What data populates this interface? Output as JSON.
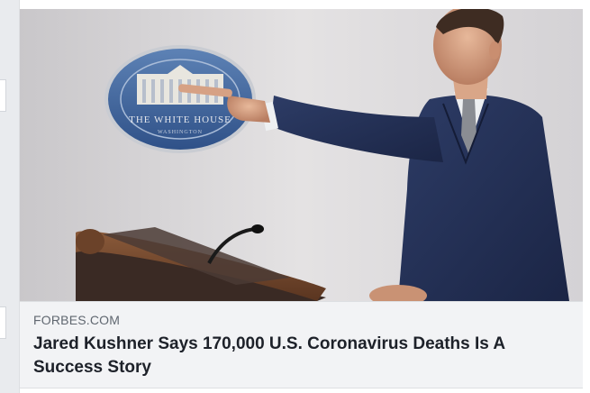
{
  "link_preview": {
    "source": "FORBES.COM",
    "headline": "Jared Kushner Says 170,000 U.S. Coronavirus Deaths Is A Success Story",
    "image_alt": "Man in a dark suit pointing from a press briefing podium in front of a White House seal"
  },
  "photo_seal": {
    "text": "THE WHITE HOUSE",
    "subtext": "WASHINGTON"
  }
}
